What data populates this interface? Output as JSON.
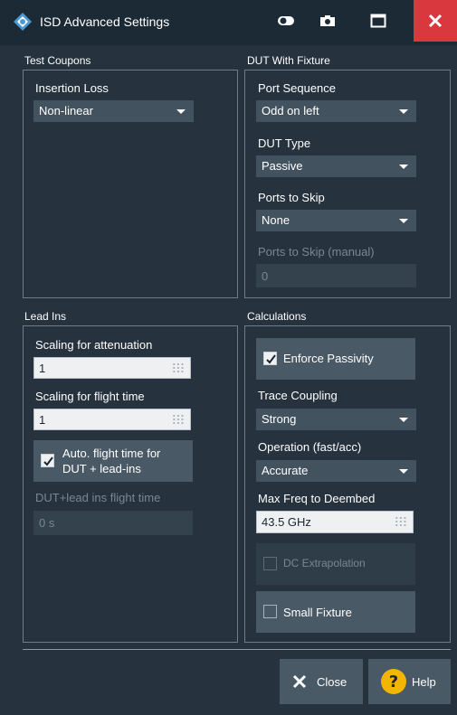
{
  "window": {
    "title": "ISD Advanced Settings",
    "controls": [
      "toggle-icon",
      "camera-icon",
      "maximize-icon",
      "close-icon"
    ]
  },
  "test_coupons": {
    "group_label": "Test Coupons",
    "insertion_loss_label": "Insertion Loss",
    "insertion_loss_value": "Non-linear"
  },
  "dut_with_fixture": {
    "group_label": "DUT With Fixture",
    "port_sequence_label": "Port Sequence",
    "port_sequence_value": "Odd on left",
    "dut_type_label": "DUT Type",
    "dut_type_value": "Passive",
    "ports_to_skip_label": "Ports to Skip",
    "ports_to_skip_value": "None",
    "ports_to_skip_manual_label": "Ports to Skip (manual)",
    "ports_to_skip_manual_value": "0"
  },
  "lead_ins": {
    "group_label": "Lead Ins",
    "scaling_attenuation_label": "Scaling for attenuation",
    "scaling_attenuation_value": "1",
    "scaling_flight_label": "Scaling for flight time",
    "scaling_flight_value": "1",
    "auto_flight_line1": "Auto. flight time for",
    "auto_flight_line2": "DUT + lead-ins",
    "auto_flight_checked": true,
    "dut_lead_flight_label": "DUT+lead ins flight time",
    "dut_lead_flight_value": "0 s"
  },
  "calculations": {
    "group_label": "Calculations",
    "enforce_passivity_label": "Enforce Passivity",
    "enforce_passivity_checked": true,
    "trace_coupling_label": "Trace Coupling",
    "trace_coupling_value": "Strong",
    "operation_label": "Operation (fast/acc)",
    "operation_value": "Accurate",
    "max_freq_label": "Max Freq to Deembed",
    "max_freq_value": "43.5 GHz",
    "dc_extrapolation_label": "DC Extrapolation",
    "dc_extrapolation_checked": false,
    "small_fixture_label": "Small Fixture",
    "small_fixture_checked": false
  },
  "footer": {
    "close_label": "Close",
    "help_label": "Help"
  },
  "colors": {
    "background": "#26323d",
    "titlebar": "#1c2a35",
    "close_button": "#d9383e",
    "dropdown": "#43525f",
    "help_accent": "#f2b600"
  }
}
